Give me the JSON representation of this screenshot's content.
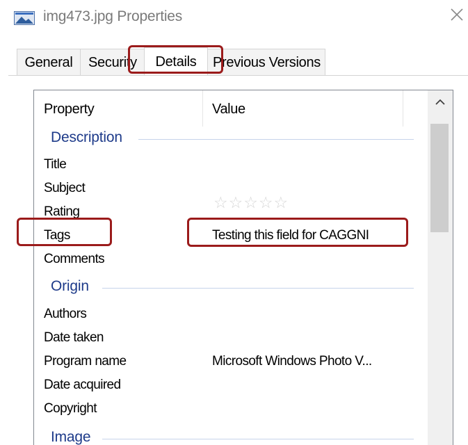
{
  "window": {
    "title": "img473.jpg Properties"
  },
  "tabs": [
    {
      "label": "General"
    },
    {
      "label": "Security"
    },
    {
      "label": "Details",
      "active": true
    },
    {
      "label": "Previous Versions"
    }
  ],
  "table": {
    "headers": {
      "property": "Property",
      "value": "Value"
    },
    "groups": [
      {
        "name": "Description",
        "rows": [
          {
            "property": "Title",
            "value": ""
          },
          {
            "property": "Subject",
            "value": ""
          },
          {
            "property": "Rating",
            "value": "",
            "rating_stars_filled": 0,
            "rating_stars_total": 5
          },
          {
            "property": "Tags",
            "value": "Testing this field for CAGGNI"
          },
          {
            "property": "Comments",
            "value": ""
          }
        ]
      },
      {
        "name": "Origin",
        "rows": [
          {
            "property": "Authors",
            "value": ""
          },
          {
            "property": "Date taken",
            "value": ""
          },
          {
            "property": "Program name",
            "value": "Microsoft Windows Photo V..."
          },
          {
            "property": "Date acquired",
            "value": ""
          },
          {
            "property": "Copyright",
            "value": ""
          }
        ]
      },
      {
        "name": "Image",
        "rows": []
      }
    ]
  },
  "icons": {
    "title_icon": "image-file-icon",
    "close": "close-icon",
    "scroll_up": "chevron-up-icon",
    "rating": "star-icon"
  },
  "colors": {
    "group_header": "#1e3b8a",
    "highlight_annotation": "#9b1b1b",
    "stars_empty": "#d6d6d6"
  }
}
